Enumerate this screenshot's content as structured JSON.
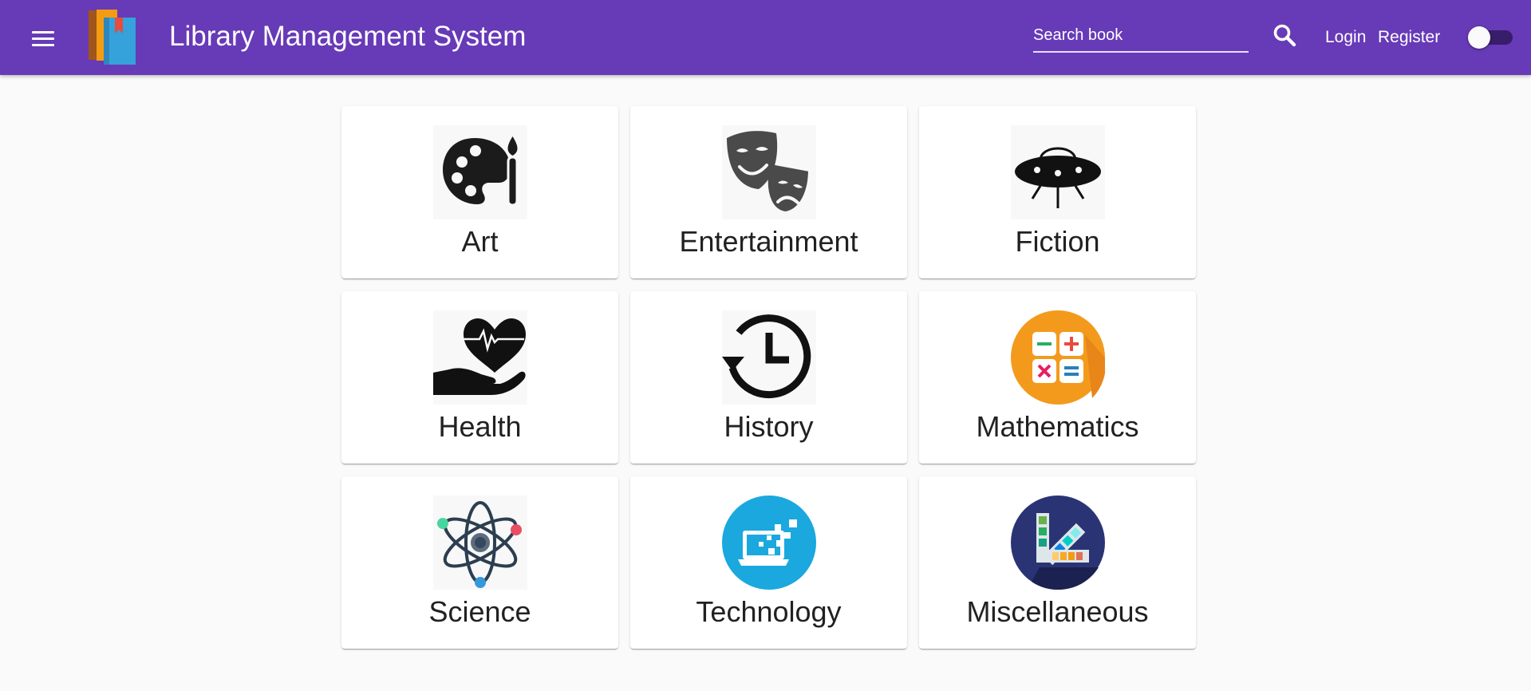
{
  "header": {
    "title": "Library Management System",
    "menu_icon": "menu-icon",
    "logo_icon": "books-logo-icon",
    "search": {
      "placeholder": "Search book",
      "value": ""
    },
    "search_icon": "search-icon",
    "login_label": "Login",
    "register_label": "Register",
    "theme_toggle": {
      "icon": "toggle-switch",
      "checked": false
    }
  },
  "theme": {
    "primary": "#673ab7",
    "background": "#fafafa",
    "card": "#ffffff",
    "text": "#212121"
  },
  "categories": [
    {
      "label": "Art",
      "icon": "palette-icon"
    },
    {
      "label": "Entertainment",
      "icon": "theater-masks-icon"
    },
    {
      "label": "Fiction",
      "icon": "ufo-icon"
    },
    {
      "label": "Health",
      "icon": "heart-in-hand-icon"
    },
    {
      "label": "History",
      "icon": "history-clock-icon"
    },
    {
      "label": "Mathematics",
      "icon": "math-operators-icon"
    },
    {
      "label": "Science",
      "icon": "atom-icon"
    },
    {
      "label": "Technology",
      "icon": "laptop-icon"
    },
    {
      "label": "Miscellaneous",
      "icon": "color-swatch-icon"
    }
  ]
}
